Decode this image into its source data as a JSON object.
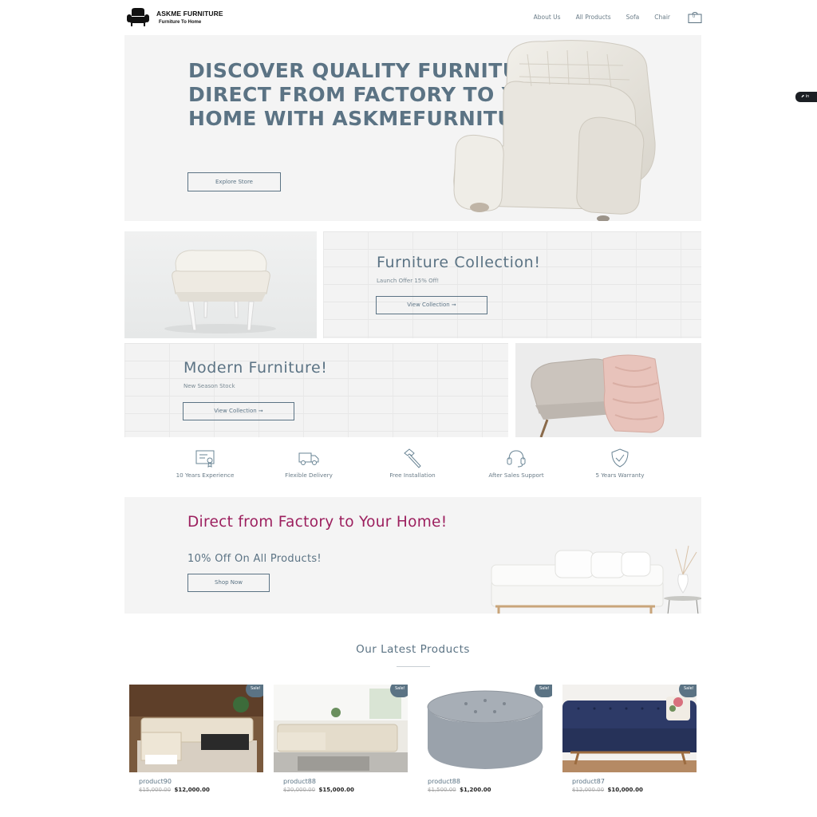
{
  "brand": {
    "name": "ASKME FURNITURE",
    "tagline": "Furniture To Home"
  },
  "nav": {
    "items": [
      "About Us",
      "All Products",
      "Sofa",
      "Chair"
    ],
    "cart_count": "0"
  },
  "hero": {
    "title": "DISCOVER QUALITY FURNITURE DIRECT FROM FACTORY TO YOUR HOME WITH ASKMEFURNITURE",
    "button": "Explore Store"
  },
  "collections": [
    {
      "title": "Furniture Collection!",
      "subtitle": "Launch Offer 15% Off!",
      "button": "View Collection ➞"
    },
    {
      "title": "Modern Furniture!",
      "subtitle": "New Season Stock",
      "button": "View Collection ➞"
    }
  ],
  "features": [
    {
      "label": "10 Years Experience",
      "icon": "certificate-icon"
    },
    {
      "label": "Flexible Delivery",
      "icon": "truck-icon"
    },
    {
      "label": "Free Installation",
      "icon": "hammer-icon"
    },
    {
      "label": "After Sales Support",
      "icon": "headset-icon"
    },
    {
      "label": "5 Years Warranty",
      "icon": "shield-check-icon"
    }
  ],
  "promo": {
    "title": "Direct from Factory to Your Home!",
    "subtitle": "10% Off On All Products!",
    "button": "Shop Now"
  },
  "latest": {
    "title": "Our Latest Products",
    "sale_badge": "Sale!",
    "products": [
      {
        "name": "product90",
        "old_price": "$15,000.00",
        "price": "$12,000.00"
      },
      {
        "name": "product88",
        "old_price": "$20,000.00",
        "price": "$15,000.00"
      },
      {
        "name": "product88",
        "old_price": "$1,500.00",
        "price": "$1,200.00"
      },
      {
        "name": "product87",
        "old_price": "$12,000.00",
        "price": "$10,000.00"
      }
    ]
  },
  "floating_widget": "in",
  "colors": {
    "accent": "#5b7384",
    "promo_title": "#9c1f5e",
    "panel_bg": "#f4f4f4"
  }
}
